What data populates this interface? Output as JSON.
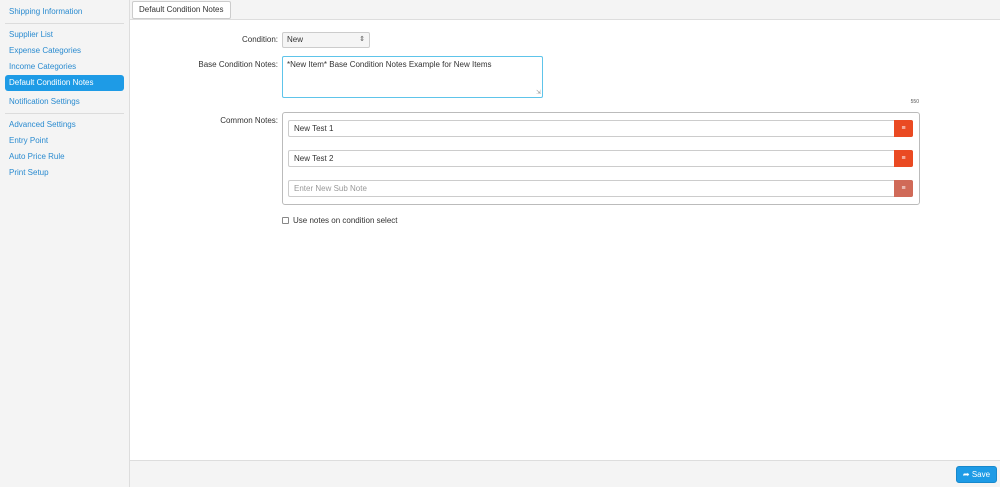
{
  "sidebar": {
    "items": [
      {
        "label": "Shipping Information"
      },
      {
        "label": "Supplier List"
      },
      {
        "label": "Expense Categories"
      },
      {
        "label": "Income Categories"
      },
      {
        "label": "Default Condition Notes",
        "active": true
      },
      {
        "label": "Notification Settings"
      },
      {
        "label": "Advanced Settings"
      },
      {
        "label": "Entry Point"
      },
      {
        "label": "Auto Price Rule"
      },
      {
        "label": "Print Setup"
      }
    ]
  },
  "topbar": {
    "tab_label": "Default Condition Notes"
  },
  "form": {
    "condition_label": "Condition:",
    "condition_value": "New",
    "base_notes_label": "Base Condition Notes:",
    "base_notes_value": "*New Item* Base Condition Notes Example for New Items",
    "char_counter": "550",
    "common_notes_label": "Common Notes:",
    "common_notes": [
      {
        "value": "New Test 1"
      },
      {
        "value": "New Test 2"
      }
    ],
    "new_note_placeholder": "Enter New Sub Note",
    "checkbox_label": "Use notes on condition select"
  },
  "footer": {
    "save_label": "Save"
  },
  "colors": {
    "accent": "#1e9be6",
    "danger": "#ea4a22"
  },
  "icons": {
    "delete": "trash-icon",
    "save": "share-arrow-icon",
    "select": "updown-caret-icon"
  }
}
